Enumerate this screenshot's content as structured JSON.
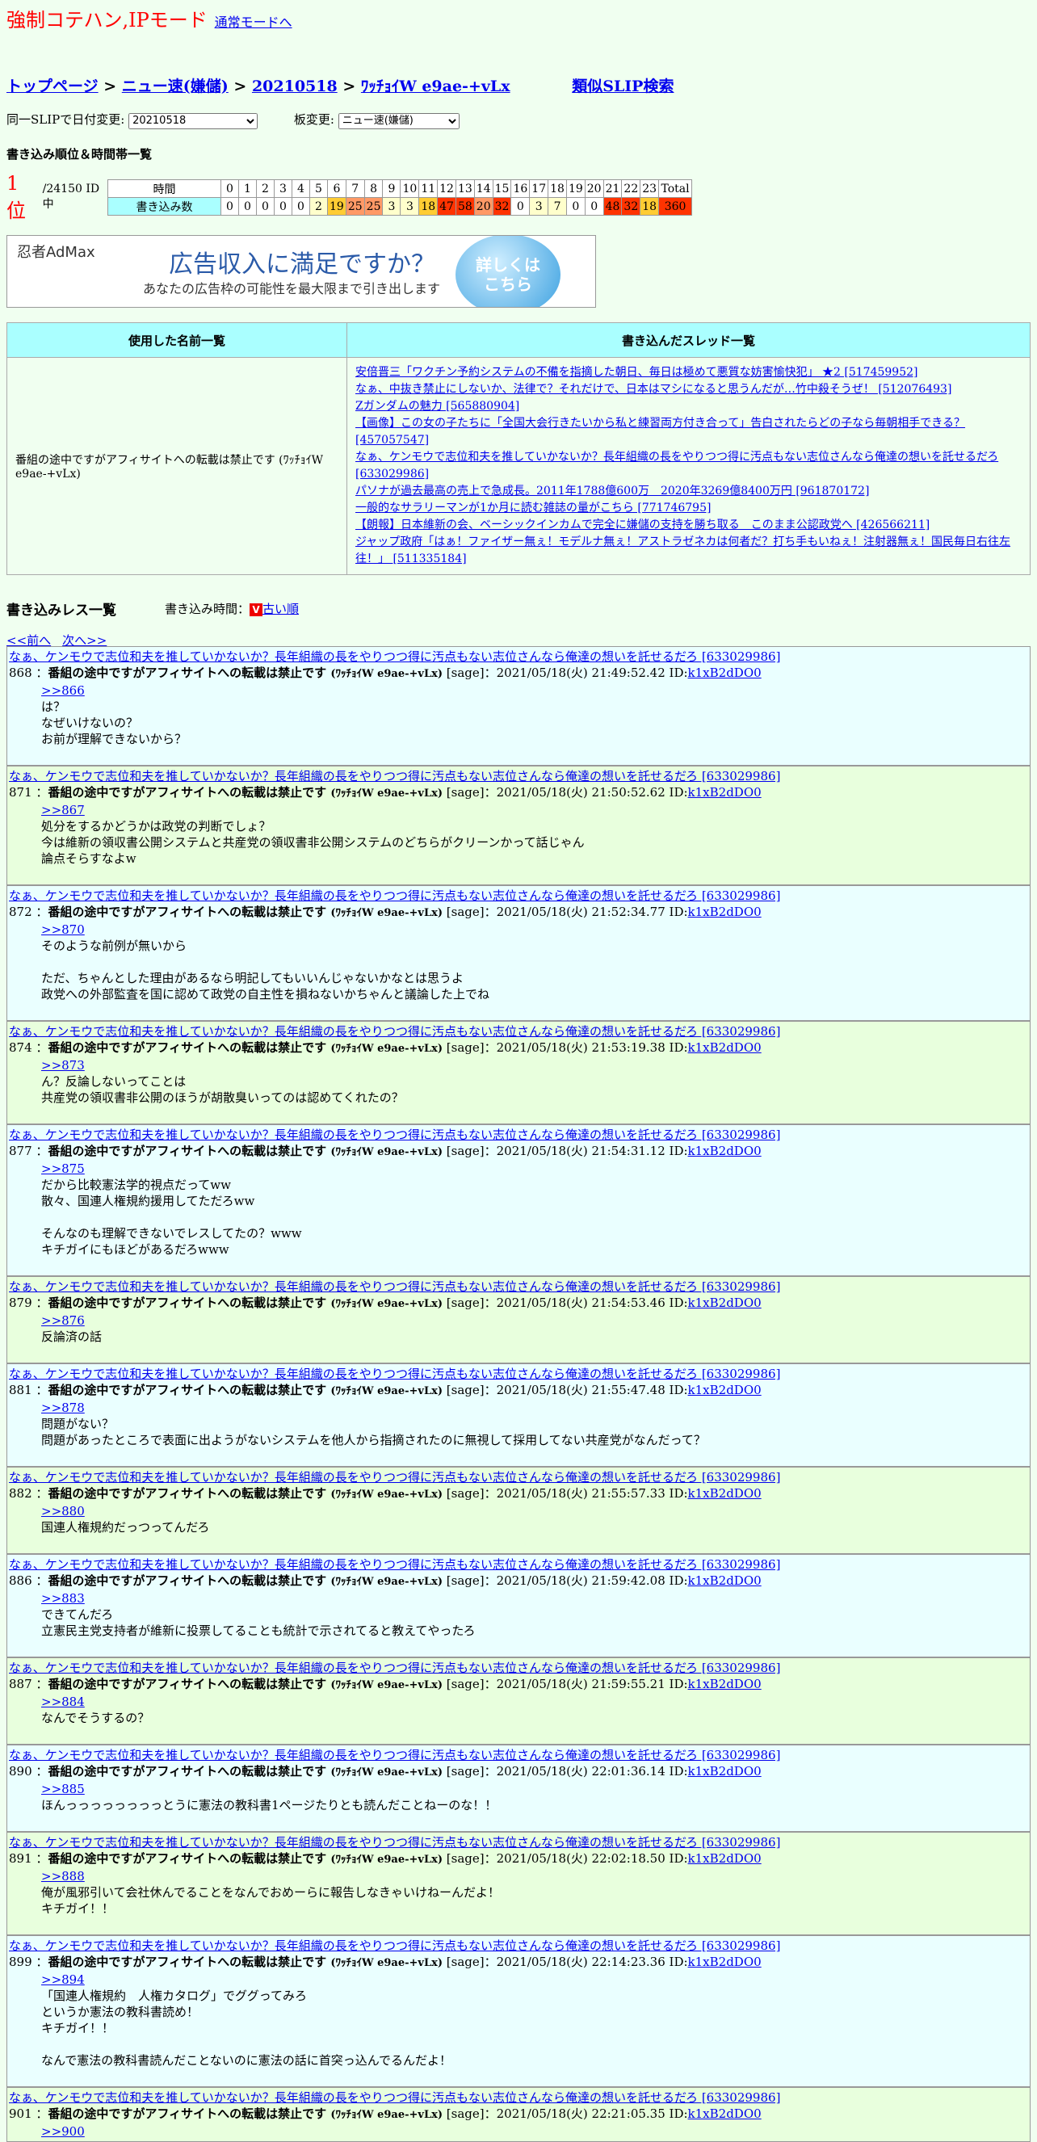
{
  "header": {
    "mode_title": "強制コテハン,IPモード",
    "normal_mode_link": "通常モードへ"
  },
  "breadcrumb": {
    "items": [
      "トップページ",
      "ニュー速(嫌儲)",
      "20210518",
      "ﾜｯﾁｮｲW e9ae-+vLx"
    ],
    "separator": ">",
    "similar_search": "類似SLIP検索"
  },
  "selectors": {
    "date_label": "同一SLIPで日付変更:",
    "date_value": "20210518",
    "board_label": "板変更:",
    "board_value": "ニュー速(嫌儲)"
  },
  "ranking": {
    "title": "書き込み順位＆時間帯一覧",
    "rank": "1 位",
    "total_ids": "/24150 ID中",
    "hour_label": "時間",
    "count_label": "書き込み数",
    "hours": [
      "0",
      "1",
      "2",
      "3",
      "4",
      "5",
      "6",
      "7",
      "8",
      "9",
      "10",
      "11",
      "12",
      "13",
      "14",
      "15",
      "16",
      "17",
      "18",
      "19",
      "20",
      "21",
      "22",
      "23",
      "Total"
    ],
    "counts": [
      "0",
      "0",
      "0",
      "0",
      "0",
      "2",
      "19",
      "25",
      "25",
      "3",
      "3",
      "18",
      "47",
      "58",
      "20",
      "32",
      "0",
      "3",
      "7",
      "0",
      "0",
      "48",
      "32",
      "18",
      "360"
    ],
    "count_colors": [
      "#ffffff",
      "#ffffff",
      "#ffffff",
      "#ffffff",
      "#ffffff",
      "#ffffcc",
      "#ffcc33",
      "#ff9966",
      "#ff9966",
      "#ffffcc",
      "#ffffcc",
      "#ffcc33",
      "#ff3300",
      "#ff3300",
      "#ff9966",
      "#ff3300",
      "#ffffff",
      "#ffffcc",
      "#ffffcc",
      "#ffffff",
      "#ffffff",
      "#ff3300",
      "#ff3300",
      "#ffcc33",
      "#ff3300"
    ]
  },
  "ad": {
    "logo": "忍者AdMax",
    "headline": "広告収入に満足ですか？",
    "sub": "あなたの広告枠の可能性を最大限まで引き出します",
    "button": "詳しくはこちら"
  },
  "names_table": {
    "col_names": "使用した名前一覧",
    "col_threads": "書き込んだスレッド一覧",
    "name": "番組の途中ですがアフィサイトへの転載は禁止です (ﾜｯﾁｮｲW e9ae-+vLx)",
    "threads": [
      "安倍晋三「ワクチン予約システムの不備を指摘した朝日、毎日は極めて悪質な妨害愉快犯」 ★2 [517459952]",
      "なぁ、中抜き禁止にしないか、法律で？それだけで、日本はマシになると思うんだが…竹中殺そうぜ！ [512076493]",
      "Zガンダムの魅力 [565880904]",
      "【画像】この女の子たちに「全国大会行きたいから私と練習両方付き合って」告白されたらどの子なら毎朝相手できる？ [457057547]",
      "なぁ、ケンモウで志位和夫を推していかないか？長年組織の長をやりつつ得に汚点もない志位さんなら俺達の想いを託せるだろ [633029986]",
      "パソナが過去最高の売上で急成長。2011年1788億600万　2020年3269億8400万円 [961870172]",
      "一般的なサラリーマンが1か月に読む雑誌の量がこちら [771746795]",
      "【朗報】日本維新の会、ベーシックインカムで完全に嫌儲の支持を勝ち取る　このまま公認政党へ [426566211]",
      "ジャップ政府「はぁ！ファイザー無ぇ！モデルナ無ぇ！アストラゼネカは何者だ？打ち手もいねぇ！注射器無ぇ！国民毎日右往左往！」 [511335184]"
    ]
  },
  "res_list": {
    "title": "書き込みレス一覧",
    "order_label": "書き込み時間：",
    "order_link": "古い順",
    "order_icon": "V",
    "prev": "<<前へ",
    "next": "次へ>>",
    "thread_title": "なぁ、ケンモウで志位和夫を推していかないか？長年組織の長をやりつつ得に汚点もない志位さんなら俺達の想いを託せるだろ [633029986]",
    "poster_name": "番組の途中ですがアフィサイトへの転載は禁止です",
    "poster_trip": "(ﾜｯﾁｮｲW e9ae-+vLx)",
    "sage": "[sage]",
    "id_label": "ID:",
    "id": "k1xB2dDO0",
    "posts": [
      {
        "no": "868",
        "time": "2021/05/18(火) 21:49:52.42",
        "anchor": ">>866",
        "lines": [
          "は？",
          "なぜいけないの？",
          "お前が理解できないから？"
        ],
        "color": "c2"
      },
      {
        "no": "871",
        "time": "2021/05/18(火) 21:50:52.62",
        "anchor": ">>867",
        "lines": [
          "処分をするかどうかは政党の判断でしょ？",
          "今は維新の領収書公開システムと共産党の領収書非公開システムのどちらがクリーンかって話じゃん",
          "論点そらすなよw"
        ],
        "color": "c1"
      },
      {
        "no": "872",
        "time": "2021/05/18(火) 21:52:34.77",
        "anchor": ">>870",
        "lines": [
          "そのような前例が無いから",
          "",
          "ただ、ちゃんとした理由があるなら明記してもいいんじゃないかなとは思うよ",
          "政党への外部監査を国に認めて政党の自主性を損ねないかちゃんと議論した上でね"
        ],
        "color": "c2"
      },
      {
        "no": "874",
        "time": "2021/05/18(火) 21:53:19.38",
        "anchor": ">>873",
        "lines": [
          "ん？反論しないってことは",
          "共産党の領収書非公開のほうが胡散臭いってのは認めてくれたの？"
        ],
        "color": "c1"
      },
      {
        "no": "877",
        "time": "2021/05/18(火) 21:54:31.12",
        "anchor": ">>875",
        "lines": [
          "だから比較憲法学的視点だってww",
          "散々、国連人権規約援用してただろww",
          "",
          "そんなのも理解できないでレスしてたの？www",
          "キチガイにもほどがあるだろwww"
        ],
        "color": "c2"
      },
      {
        "no": "879",
        "time": "2021/05/18(火) 21:54:53.46",
        "anchor": ">>876",
        "lines": [
          "反論済の話"
        ],
        "color": "c1"
      },
      {
        "no": "881",
        "time": "2021/05/18(火) 21:55:47.48",
        "anchor": ">>878",
        "lines": [
          "問題がない？",
          "問題があったところで表面に出ようがないシステムを他人から指摘されたのに無視して採用してない共産党がなんだって？"
        ],
        "color": "c2"
      },
      {
        "no": "882",
        "time": "2021/05/18(火) 21:55:57.33",
        "anchor": ">>880",
        "lines": [
          "国連人権規約だっつってんだろ"
        ],
        "color": "c1"
      },
      {
        "no": "886",
        "time": "2021/05/18(火) 21:59:42.08",
        "anchor": ">>883",
        "lines": [
          "できてんだろ",
          "立憲民主党支持者が維新に投票してることも統計で示されてると教えてやったろ"
        ],
        "color": "c2"
      },
      {
        "no": "887",
        "time": "2021/05/18(火) 21:59:55.21",
        "anchor": ">>884",
        "lines": [
          "なんでそうするの？"
        ],
        "color": "c1"
      },
      {
        "no": "890",
        "time": "2021/05/18(火) 22:01:36.14",
        "anchor": ">>885",
        "lines": [
          "ほんっっっっっっっっとうに憲法の教科書1ページたりとも読んだことねーのな！！"
        ],
        "color": "c2"
      },
      {
        "no": "891",
        "time": "2021/05/18(火) 22:02:18.50",
        "anchor": ">>888",
        "lines": [
          "俺が風邪引いて会社休んでることをなんでおめーらに報告しなきゃいけねーんだよ！",
          "キチガイ！！"
        ],
        "color": "c1"
      },
      {
        "no": "899",
        "time": "2021/05/18(火) 22:14:23.36",
        "anchor": ">>894",
        "lines": [
          "「国連人権規約　人権カタログ」でググってみろ",
          "というか憲法の教科書読め！",
          "キチガイ！！",
          "",
          "なんで憲法の教科書読んだことないのに憲法の話に首突っ込んでるんだよ！"
        ],
        "color": "c2"
      },
      {
        "no": "901",
        "time": "2021/05/18(火) 22:21:05.35",
        "anchor": ">>900",
        "lines": [],
        "color": "c1"
      }
    ]
  }
}
